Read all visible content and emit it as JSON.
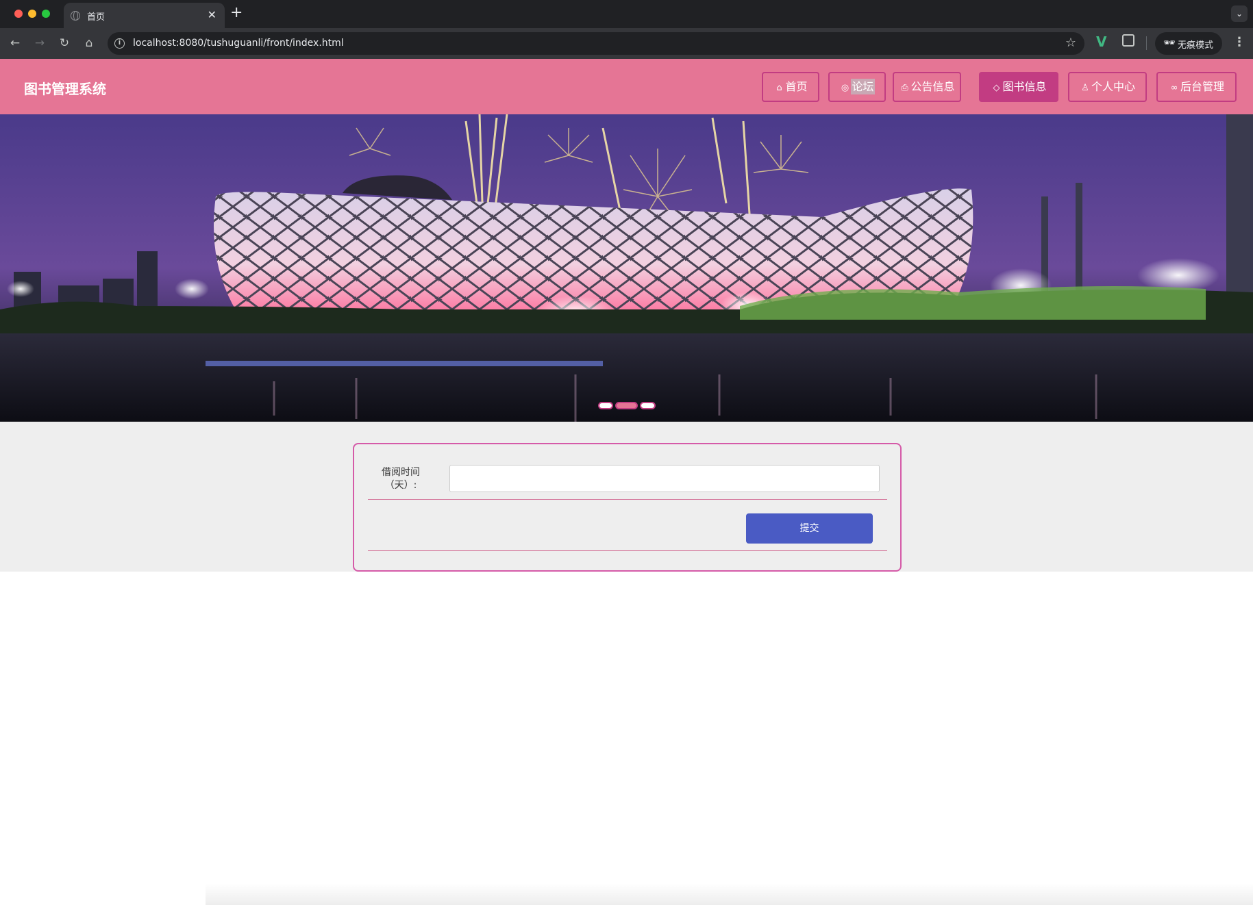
{
  "browser": {
    "tab_title": "首页",
    "tab_close": "✕",
    "new_tab": "+",
    "url": "localhost:8080/tushuguanli/front/index.html",
    "incognito_label": "无痕模式",
    "icons": [
      "globe-icon",
      "back-icon",
      "forward-icon",
      "reload-icon",
      "home-icon",
      "info-icon",
      "star-icon",
      "vue-devtools-icon",
      "puzzle-icon",
      "incognito-icon",
      "kebab-menu-icon",
      "chevron-down-icon"
    ]
  },
  "site": {
    "title": "图书管理系统",
    "nav": [
      {
        "label": "首页",
        "icon": "home-icon",
        "active": false
      },
      {
        "label": "论坛",
        "icon": "globe-icon",
        "active": false
      },
      {
        "label": "公告信息",
        "icon": "printer-icon",
        "active": false
      },
      {
        "label": "图书信息",
        "icon": "tag-icon",
        "active": true
      },
      {
        "label": "个人中心",
        "icon": "user-icon",
        "active": false
      },
      {
        "label": "后台管理",
        "icon": "link-icon",
        "active": false
      }
    ],
    "colors": {
      "header": "#e57595",
      "accent": "#c23c82",
      "submit": "#4a5bc4"
    }
  },
  "banner": {
    "dots": 3,
    "active_dot": 2
  },
  "form": {
    "label_line1": "借阅时间",
    "label_line2": "（天）:",
    "value": "",
    "submit_label": "提交"
  }
}
